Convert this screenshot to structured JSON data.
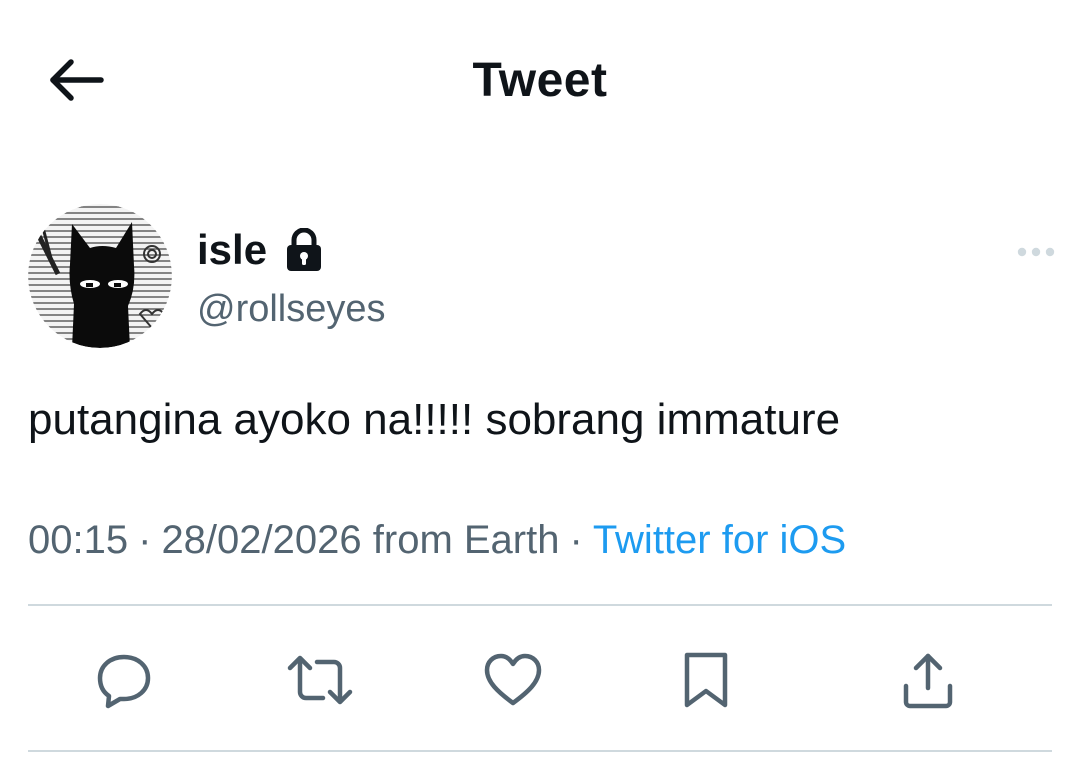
{
  "header": {
    "title": "Tweet",
    "back_icon": "arrow-left-icon"
  },
  "author": {
    "display_name": "isle",
    "handle": "@rollseyes",
    "protected_icon": "lock-icon",
    "avatar": "black-cat-avatar"
  },
  "tweet": {
    "text": "putangina ayoko na!!!!! sobrang immature",
    "time": "00:15",
    "date": "28/02/2026",
    "location": "from Earth",
    "source": "Twitter for iOS",
    "separator": "·"
  },
  "actions": [
    {
      "name": "reply",
      "icon": "reply-icon"
    },
    {
      "name": "retweet",
      "icon": "retweet-icon"
    },
    {
      "name": "like",
      "icon": "heart-icon"
    },
    {
      "name": "bookmark",
      "icon": "bookmark-icon"
    },
    {
      "name": "share",
      "icon": "share-icon"
    }
  ],
  "colors": {
    "text_primary": "#0f1419",
    "text_secondary": "#536471",
    "link": "#1d9bf0",
    "divider": "#cfd9de"
  }
}
